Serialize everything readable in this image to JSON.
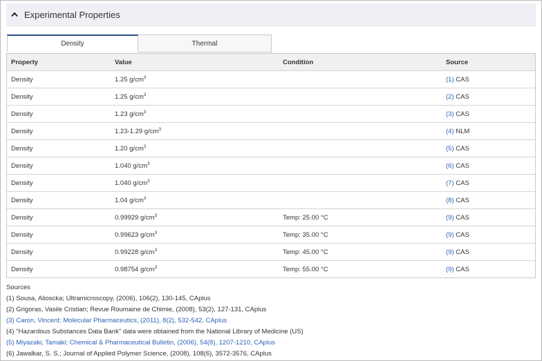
{
  "section": {
    "title": "Experimental Properties"
  },
  "tabs": [
    {
      "label": "Density"
    },
    {
      "label": "Thermal"
    }
  ],
  "table": {
    "headers": {
      "property": "Property",
      "value": "Value",
      "condition": "Condition",
      "source": "Source"
    },
    "unit_base": "g/cm",
    "unit_exp": "3",
    "rows": [
      {
        "property": "Density",
        "value": "1.25",
        "condition": "",
        "ref": "(1)",
        "source": "CAS"
      },
      {
        "property": "Density",
        "value": "1.25",
        "condition": "",
        "ref": "(2)",
        "source": "CAS"
      },
      {
        "property": "Density",
        "value": "1.23",
        "condition": "",
        "ref": "(3)",
        "source": "CAS"
      },
      {
        "property": "Density",
        "value": "1.23-1.29",
        "condition": "",
        "ref": "(4)",
        "source": "NLM"
      },
      {
        "property": "Density",
        "value": "1.20",
        "condition": "",
        "ref": "(5)",
        "source": "CAS"
      },
      {
        "property": "Density",
        "value": "1.040",
        "condition": "",
        "ref": "(6)",
        "source": "CAS"
      },
      {
        "property": "Density",
        "value": "1.040",
        "condition": "",
        "ref": "(7)",
        "source": "CAS"
      },
      {
        "property": "Density",
        "value": "1.04",
        "condition": "",
        "ref": "(8)",
        "source": "CAS"
      },
      {
        "property": "Density",
        "value": "0.99929",
        "condition": "Temp: 25.00 °C",
        "ref": "(9)",
        "source": "CAS"
      },
      {
        "property": "Density",
        "value": "0.99623",
        "condition": "Temp: 35.00 °C",
        "ref": "(9)",
        "source": "CAS"
      },
      {
        "property": "Density",
        "value": "0.99228",
        "condition": "Temp: 45.00 °C",
        "ref": "(9)",
        "source": "CAS"
      },
      {
        "property": "Density",
        "value": "0.98754",
        "condition": "Temp: 55.00 °C",
        "ref": "(9)",
        "source": "CAS"
      }
    ]
  },
  "sources": {
    "heading": "Sources",
    "items": [
      {
        "text": "(1) Sousa, Alioscka; Ultramicroscopy, (2006), 106(2), 130-145, CAplus",
        "link": false
      },
      {
        "text": "(2) Grigoras, Vasile Cristian; Revue Roumaine de Chimie, (2008), 53(2), 127-131, CAplus",
        "link": false
      },
      {
        "text": "(3) Caron, Vincent; Molecular Pharmaceutics, (2011), 8(2), 532-542, CAplus",
        "link": true
      },
      {
        "text": "(4) \"Hazardous Substances Data Bank\" data were obtained from the National Library of Medicine (US)",
        "link": false
      },
      {
        "text": "(5) Miyazaki, Tamaki; Chemical & Pharmaceutical Bulletin, (2006), 54(8), 1207-1210, CAplus",
        "link": true
      },
      {
        "text": "(6) Jawalkar, S. S.; Journal of Applied Polymer Science, (2008), 108(6), 3572-3576, CAplus",
        "link": false
      }
    ]
  },
  "colors": {
    "accent": "#2a4d8f",
    "link": "#2a62b5",
    "header_bg": "#eef0f5"
  },
  "icons": {
    "collapse": "chevron-up-icon"
  }
}
